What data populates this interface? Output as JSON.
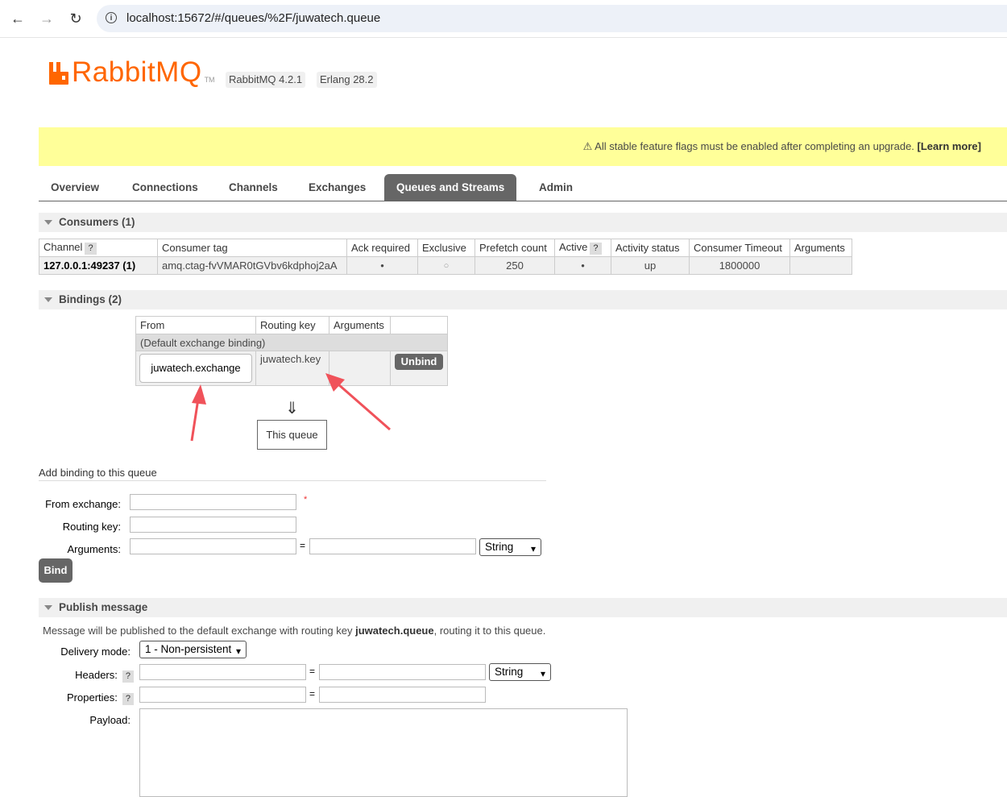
{
  "browser": {
    "url": "localhost:15672/#/queues/%2F/juwatech.queue"
  },
  "header": {
    "logo_text": "RabbitMQ",
    "logo_tm": "TM",
    "rabbitmq_version": "RabbitMQ 4.2.1",
    "erlang_version": "Erlang 28.2"
  },
  "banner": {
    "text": "⚠ All stable feature flags must be enabled after completing an upgrade.",
    "link": "[Learn more]"
  },
  "tabs": [
    {
      "label": "Overview"
    },
    {
      "label": "Connections"
    },
    {
      "label": "Channels"
    },
    {
      "label": "Exchanges"
    },
    {
      "label": "Queues and Streams",
      "active": true
    },
    {
      "label": "Admin"
    }
  ],
  "consumers": {
    "title": "Consumers (1)",
    "headers": [
      "Channel",
      "Consumer tag",
      "Ack required",
      "Exclusive",
      "Prefetch count",
      "Active",
      "Activity status",
      "Consumer Timeout",
      "Arguments"
    ],
    "help_mark": "?",
    "row": {
      "channel": "127.0.0.1:49237 (1)",
      "consumer_tag": "amq.ctag-fvVMAR0tGVbv6kdphoj2aA",
      "ack_required": "●",
      "exclusive": "○",
      "prefetch_count": "250",
      "active": "●",
      "activity_status": "up",
      "consumer_timeout": "1800000",
      "arguments": ""
    }
  },
  "bindings": {
    "title": "Bindings (2)",
    "headers": [
      "From",
      "Routing key",
      "Arguments"
    ],
    "default_binding": "(Default exchange binding)",
    "row": {
      "from": "juwatech.exchange",
      "routing_key": "juwatech.key",
      "unbind_label": "Unbind"
    },
    "down_arrow": "⇓",
    "this_queue": "This queue"
  },
  "add_binding": {
    "title": "Add binding to this queue",
    "from_exchange_label": "From exchange:",
    "required_mark": "*",
    "routing_key_label": "Routing key:",
    "arguments_label": "Arguments:",
    "eq": "=",
    "type_select": "String",
    "bind_label": "Bind"
  },
  "publish": {
    "title": "Publish message",
    "desc_prefix": "Message will be published to the default exchange with routing key ",
    "desc_key": "juwatech.queue",
    "desc_suffix": ", routing it to this queue.",
    "delivery_mode_label": "Delivery mode:",
    "delivery_mode_value": "1 - Non-persistent",
    "headers_label": "Headers:",
    "properties_label": "Properties:",
    "payload_label": "Payload:",
    "help_mark": "?",
    "eq": "=",
    "type_select": "String"
  },
  "colors": {
    "brand_orange": "#ff6600",
    "banner_yellow": "#ffff99",
    "tab_active": "#666666",
    "annotation_arrow": "#f0525a"
  }
}
